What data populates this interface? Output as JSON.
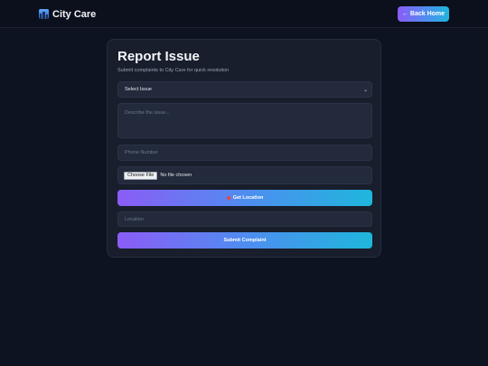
{
  "header": {
    "brand_name": "City Care",
    "brand_icon": "cityscape-icon",
    "home_button_label": "Back Home",
    "home_button_arrow": "←"
  },
  "form": {
    "title": "Report Issue",
    "subtitle": "Submit complaints to City Care for quick resolution",
    "issue_select": {
      "selected": "Select Issue"
    },
    "description": {
      "placeholder": "Describe the issue..."
    },
    "phone": {
      "placeholder": "Phone Number"
    },
    "file": {
      "button_label": "Choose File",
      "status": "No file chosen"
    },
    "location_button": {
      "label": "Get Location",
      "icon": "map-pin-icon"
    },
    "location": {
      "placeholder": "Location"
    },
    "submit_label": "Submit Complaint"
  },
  "colors": {
    "background": "#0e1322",
    "card": "#181e2c",
    "input": "#222a3b",
    "gradient_start": "#8b5cf6",
    "gradient_end": "#1fb6dc"
  }
}
